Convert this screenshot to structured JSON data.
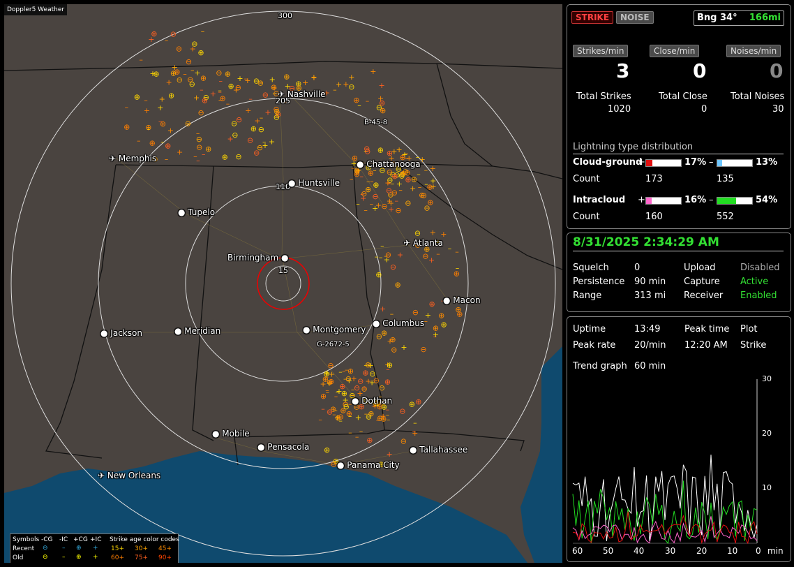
{
  "app_title": "Doppler5 Weather",
  "range_labels": [
    "300",
    "205",
    "110",
    "15"
  ],
  "cities": [
    {
      "name": "Nashville",
      "kind": "airport"
    },
    {
      "name": "Memphis",
      "kind": "airport"
    },
    {
      "name": "Chattanooga",
      "kind": "dot"
    },
    {
      "name": "Huntsville",
      "kind": "dot"
    },
    {
      "name": "Tupelo",
      "kind": "dot"
    },
    {
      "name": "Atlanta",
      "kind": "airport"
    },
    {
      "name": "Birmingham",
      "kind": "dot"
    },
    {
      "name": "Macon",
      "kind": "dot"
    },
    {
      "name": "Jackson",
      "kind": "dot"
    },
    {
      "name": "Meridian",
      "kind": "dot"
    },
    {
      "name": "Montgomery",
      "kind": "dot"
    },
    {
      "name": "Columbus",
      "kind": "dot"
    },
    {
      "name": "Dothan",
      "kind": "dot"
    },
    {
      "name": "Mobile",
      "kind": "dot"
    },
    {
      "name": "Pensacola",
      "kind": "dot"
    },
    {
      "name": "Tallahassee",
      "kind": "dot"
    },
    {
      "name": "Panama City",
      "kind": "dot"
    },
    {
      "name": "New Orleans",
      "kind": "airport"
    }
  ],
  "map_tags": [
    "B-45-8",
    "G-2672-5"
  ],
  "legend": {
    "header_symbols": "Symbols",
    "col_neg_cg": "-CG",
    "col_neg_ic": "-IC",
    "col_pos_cg": "+CG",
    "col_pos_ic": "+IC",
    "age_title": "Strike age color codes",
    "row_recent": "Recent",
    "row_old": "Old",
    "age_recent": [
      "15+",
      "30+",
      "45+"
    ],
    "age_old": [
      "60+",
      "75+",
      "90+"
    ],
    "colors_recent": [
      "#ffd700",
      "#ffa500",
      "#ff8c00"
    ],
    "colors_old": [
      "#ff7f00",
      "#ff6020",
      "#ff4500"
    ]
  },
  "top": {
    "strike_btn": "STRIKE",
    "noise_btn": "NOISE",
    "bearing": "Bng 34°",
    "distance": "166mi",
    "strikes_per_min_btn": "Strikes/min",
    "close_per_min_btn": "Close/min",
    "noises_per_min_btn": "Noises/min",
    "strikes_per_min": "3",
    "close_per_min": "0",
    "noises_per_min": "0",
    "total_strikes_label": "Total Strikes",
    "total_close_label": "Total Close",
    "total_noises_label": "Total Noises",
    "total_strikes": "1020",
    "total_close": "0",
    "total_noises": "30",
    "dist_title": "Lightning type distribution",
    "cg_label": "Cloud-ground",
    "ic_label": "Intracloud",
    "count_label": "Count",
    "plus": "+",
    "minus": "–",
    "cg_pos_pct": "17%",
    "cg_neg_pct": "13%",
    "cg_pos_count": "173",
    "cg_neg_count": "135",
    "ic_pos_pct": "16%",
    "ic_neg_pct": "54%",
    "ic_pos_count": "160",
    "ic_neg_count": "552",
    "cg_pos_frac": 0.17,
    "cg_neg_frac": 0.13,
    "ic_pos_frac": 0.16,
    "ic_neg_frac": 0.54,
    "color_cg_pos": "#e01010",
    "color_cg_neg": "#6ec6ff",
    "color_ic_pos": "#ff66cc",
    "color_ic_neg": "#22dd22"
  },
  "status": {
    "datetime": "8/31/2025 2:34:29 AM",
    "squelch_label": "Squelch",
    "squelch": "0",
    "persistence_label": "Persistence",
    "persistence": "90 min",
    "range_label": "Range",
    "range": "313 mi",
    "upload_label": "Upload",
    "upload": "Disabled",
    "capture_label": "Capture",
    "capture": "Active",
    "receiver_label": "Receiver",
    "receiver": "Enabled"
  },
  "trend": {
    "uptime_label": "Uptime",
    "uptime": "13:49",
    "peak_time_label": "Peak time",
    "peak_time": "12:20 AM",
    "plot_label": "Plot",
    "plot": "Strike",
    "peak_rate_label": "Peak rate",
    "peak_rate": "20/min",
    "trend_label": "Trend graph",
    "trend_span": "60 min",
    "y_ticks": [
      "30",
      "20",
      "10"
    ],
    "x_ticks": [
      "60",
      "50",
      "40",
      "30",
      "20",
      "10",
      "0"
    ],
    "x_unit": "min"
  }
}
